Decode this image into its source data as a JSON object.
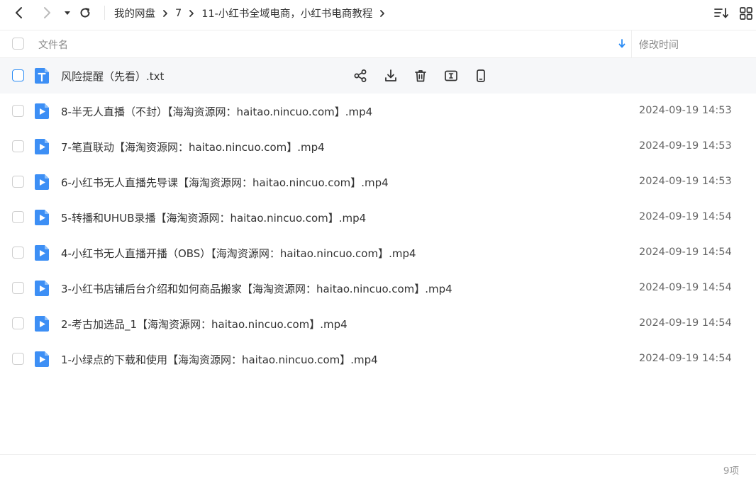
{
  "breadcrumb": [
    "我的网盘",
    "7",
    "11-小红书全域电商，小红书电商教程"
  ],
  "columns": {
    "name": "文件名",
    "modified": "修改时间"
  },
  "files": [
    {
      "name": "风险提醒（先看）.txt",
      "time": "",
      "type": "txt"
    },
    {
      "name": "8-半无人直播（不封）【海淘资源网：haitao.nincuo.com】.mp4",
      "time": "2024-09-19 14:53",
      "type": "video"
    },
    {
      "name": "7-笔直联动【海淘资源网：haitao.nincuo.com】.mp4",
      "time": "2024-09-19 14:53",
      "type": "video"
    },
    {
      "name": "6-小红书无人直播先导课【海淘资源网：haitao.nincuo.com】.mp4",
      "time": "2024-09-19 14:53",
      "type": "video"
    },
    {
      "name": "5-转播和UHUB录播【海淘资源网：haitao.nincuo.com】.mp4",
      "time": "2024-09-19 14:54",
      "type": "video"
    },
    {
      "name": "4-小红书无人直播开播（OBS）【海淘资源网：haitao.nincuo.com】.mp4",
      "time": "2024-09-19 14:54",
      "type": "video"
    },
    {
      "name": "3-小红书店铺后台介绍和如何商品搬家【海淘资源网：haitao.nincuo.com】.mp4",
      "time": "2024-09-19 14:54",
      "type": "video"
    },
    {
      "name": "2-考古加选品_1【海淘资源网：haitao.nincuo.com】.mp4",
      "time": "2024-09-19 14:54",
      "type": "video"
    },
    {
      "name": "1-小绿点的下载和使用【海淘资源网：haitao.nincuo.com】.mp4",
      "time": "2024-09-19 14:54",
      "type": "video"
    }
  ],
  "footer": {
    "count": "9项"
  },
  "colors": {
    "accent": "#2b8cf5",
    "icon_blue": "#3d8ff5",
    "text": "#333333",
    "muted": "#888888"
  }
}
